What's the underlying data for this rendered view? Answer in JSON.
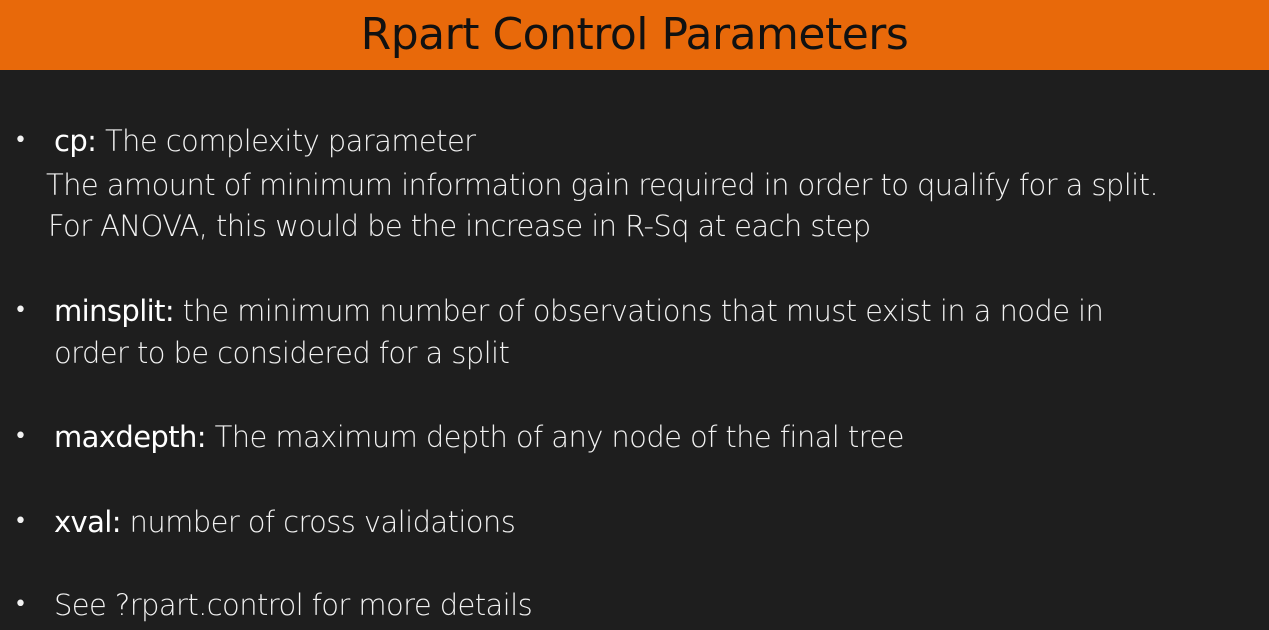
{
  "slide": {
    "title": "Rpart Control Parameters",
    "bullets": [
      {
        "term": "cp:",
        "text": " The complexity parameter",
        "extra_lines": [
          "The amount of minimum information gain required in order to qualify for a split.",
          "For ANOVA, this would be the increase in R-Sq at each step"
        ]
      },
      {
        "term": "minsplit:",
        "text": " the minimum number of observations that must exist in a node in",
        "extra_lines": [
          "order to be considered for a split"
        ]
      },
      {
        "term": "maxdepth:",
        "text": " The maximum depth of any node of the final tree",
        "extra_lines": []
      },
      {
        "term": "xval:",
        "text": " number of cross validations",
        "extra_lines": []
      },
      {
        "term": "",
        "text": "See ?rpart.control for more details",
        "extra_lines": []
      }
    ]
  },
  "colors": {
    "title_bar": "#e8690a",
    "background": "#1e1e1e",
    "title_text": "#111111",
    "body_text": "#f2f2f2"
  }
}
